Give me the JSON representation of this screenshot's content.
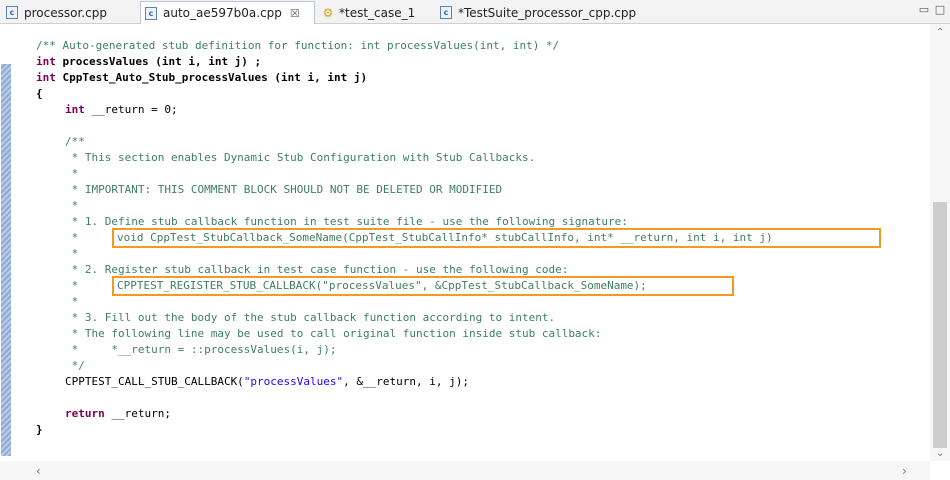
{
  "tabs": [
    {
      "label": "processor.cpp",
      "icon": "cpp-file-icon",
      "active": false
    },
    {
      "label": "auto_ae597b0a.cpp",
      "icon": "cpp-file-icon",
      "active": true,
      "close": "☒"
    },
    {
      "label": "*test_case_1",
      "icon": "gear-icon",
      "active": false
    },
    {
      "label": "*TestSuite_processor_cpp.cpp",
      "icon": "cpp-file-icon",
      "active": false
    }
  ],
  "window_controls": {
    "minimize": "▭",
    "maximize": "□"
  },
  "code": {
    "l1": "/** Auto-generated stub definition for function: int processValues(int, int) */",
    "l2_kw": "int",
    "l2_rest": " processValues (int i, int j) ;",
    "l3_kw": "int",
    "l3_rest": " CppTest_Auto_Stub_processValues (int i, int j)",
    "l4": "{",
    "l5_kw": "int",
    "l5_rest": " __return = 0;",
    "l6": "/**",
    "l7": " * This section enables Dynamic Stub Configuration with Stub Callbacks.",
    "l8": " *",
    "l9": " * IMPORTANT: THIS COMMENT BLOCK SHOULD NOT BE DELETED OR MODIFIED",
    "l10": " *",
    "l11": " * 1. Define stub callback function in test suite file - use the following signature:",
    "l12_star": " *",
    "l12_code": "void CppTest_StubCallback_SomeName(CppTest_StubCallInfo* stubCallInfo, int* __return, int i, int j)",
    "l13": " *",
    "l14": " * 2. Register stub callback in test case function - use the following code:",
    "l15_star": " *",
    "l15_code": "CPPTEST_REGISTER_STUB_CALLBACK(\"processValues\", &CppTest_StubCallback_SomeName);",
    "l16": " *",
    "l17": " * 3. Fill out the body of the stub callback function according to intent.",
    "l18": " * The following line may be used to call original function inside stub callback:",
    "l19": " *     *__return = ::processValues(i, j);",
    "l20": " */",
    "l21_a": "CPPTEST_CALL_STUB_CALLBACK(",
    "l21_str": "\"processValues\"",
    "l21_b": ", &__return, i, j);",
    "l22_kw": "return",
    "l22_rest": " __return;",
    "l23": "}"
  },
  "colors": {
    "highlight_box": "#f39a22",
    "keyword": "#7f0055",
    "comment": "#3f7f5f",
    "string": "#2a00ff"
  }
}
